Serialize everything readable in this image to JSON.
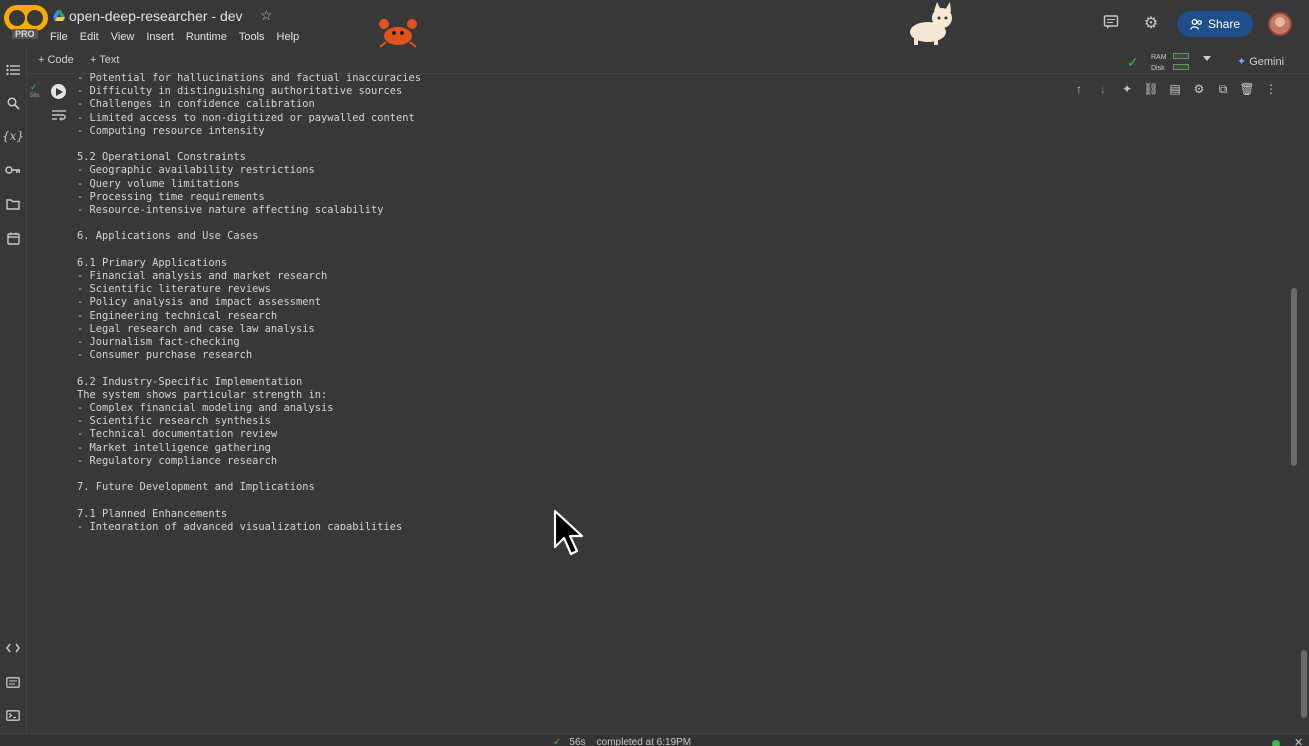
{
  "header": {
    "title": "open-deep-researcher - dev",
    "logo_text": "PRO",
    "menu": [
      "File",
      "Edit",
      "View",
      "Insert",
      "Runtime",
      "Tools",
      "Help"
    ],
    "share_label": "Share"
  },
  "toolbar": {
    "add_code": "+ Code",
    "add_text": "+ Text",
    "ram_label": "RAM",
    "disk_label": "Disk",
    "gemini_label": "Gemini"
  },
  "cell": {
    "exec_time": "56s",
    "output_lines": [
      "- Potential for hallucinations and factual inaccuracies",
      "- Difficulty in distinguishing authoritative sources",
      "- Challenges in confidence calibration",
      "- Limited access to non-digitized or paywalled content",
      "- Computing resource intensity",
      "",
      "5.2 Operational Constraints",
      "- Geographic availability restrictions",
      "- Query volume limitations",
      "- Processing time requirements",
      "- Resource-intensive nature affecting scalability",
      "",
      "6. Applications and Use Cases",
      "",
      "6.1 Primary Applications",
      "- Financial analysis and market research",
      "- Scientific literature reviews",
      "- Policy analysis and impact assessment",
      "- Engineering technical research",
      "- Legal research and case law analysis",
      "- Journalism fact-checking",
      "- Consumer purchase research",
      "",
      "6.2 Industry-Specific Implementation",
      "The system shows particular strength in:",
      "- Complex financial modeling and analysis",
      "- Scientific research synthesis",
      "- Technical documentation review",
      "- Market intelligence gathering",
      "- Regulatory compliance research",
      "",
      "7. Future Development and Implications",
      "",
      "7.1 Planned Enhancements",
      "- Integration of advanced visualization capabilities"
    ]
  },
  "statusbar": {
    "duration": "56s",
    "completed": "completed at 6:19PM"
  },
  "colors": {
    "background": "#383838",
    "share_button": "#1e4f8a",
    "success": "#3cba54"
  }
}
